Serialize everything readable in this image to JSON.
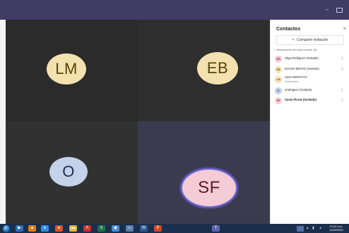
{
  "window": {
    "minimize_glyph": "–",
    "maximize_glyph": ""
  },
  "tiles": [
    {
      "initials": "LM"
    },
    {
      "initials": "EB"
    },
    {
      "initials": "O"
    },
    {
      "initials": "SF"
    }
  ],
  "panel": {
    "title": "Contactos",
    "close_glyph": "✕",
    "share_label": "Compartir invitación",
    "section_label": "Actualmente en esta reunión (5)",
    "participants": [
      {
        "initials": "OR",
        "name": "Olga Rodriguez (Invitado)",
        "role": "",
        "color": "#f5cbd7",
        "text": "#8a1c3c",
        "bold": false
      },
      {
        "initials": "EB",
        "name": "ELIANA BRAVO (Invitado)",
        "role": "",
        "color": "#f3e1b0",
        "text": "#7a5a05",
        "bold": false
      },
      {
        "initials": "LM",
        "name": "LEZA MONTOYA",
        "role": "Organizador",
        "color": "#f3e1b0",
        "text": "#7a5a05",
        "bold": false
      },
      {
        "initials": "O",
        "name": "orodriguez (Invitado)",
        "role": "",
        "color": "#c4d2ea",
        "text": "#1d2d52",
        "bold": false
      },
      {
        "initials": "SF",
        "name": "Sonia Florez (Invitado)",
        "role": "",
        "color": "#f5cbd7",
        "text": "#8a1c3c",
        "bold": true
      }
    ]
  },
  "taskbar": {
    "clock_time": "10:32 a.m.",
    "clock_date": "11/05/2020",
    "apps": [
      {
        "icon": "media-player-icon",
        "glyph": "▶",
        "color": "#2f6fb8"
      },
      {
        "icon": "vlc-icon",
        "glyph": "▲",
        "color": "#e47c15"
      },
      {
        "icon": "ie-icon",
        "glyph": "e",
        "color": "#2b8ee0"
      },
      {
        "icon": "paint-icon",
        "glyph": "●",
        "color": "#d9572a"
      },
      {
        "icon": "folder-icon",
        "glyph": "▬",
        "color": "#e8b53c"
      },
      {
        "icon": "pdf-icon",
        "glyph": "A",
        "color": "#c9302c"
      },
      {
        "icon": "excel-icon",
        "glyph": "X",
        "color": "#207245"
      },
      {
        "icon": "chrome-icon",
        "glyph": "◉",
        "color": "#4b8bd6"
      },
      {
        "icon": "explorer-icon",
        "glyph": "▭",
        "color": "#5a7fa8"
      },
      {
        "icon": "word-icon",
        "glyph": "W",
        "color": "#2b579a"
      },
      {
        "icon": "powerpoint-icon",
        "glyph": "P",
        "color": "#d24726"
      },
      {
        "icon": "teams-icon",
        "glyph": "T",
        "color": "#6264a7"
      }
    ]
  }
}
